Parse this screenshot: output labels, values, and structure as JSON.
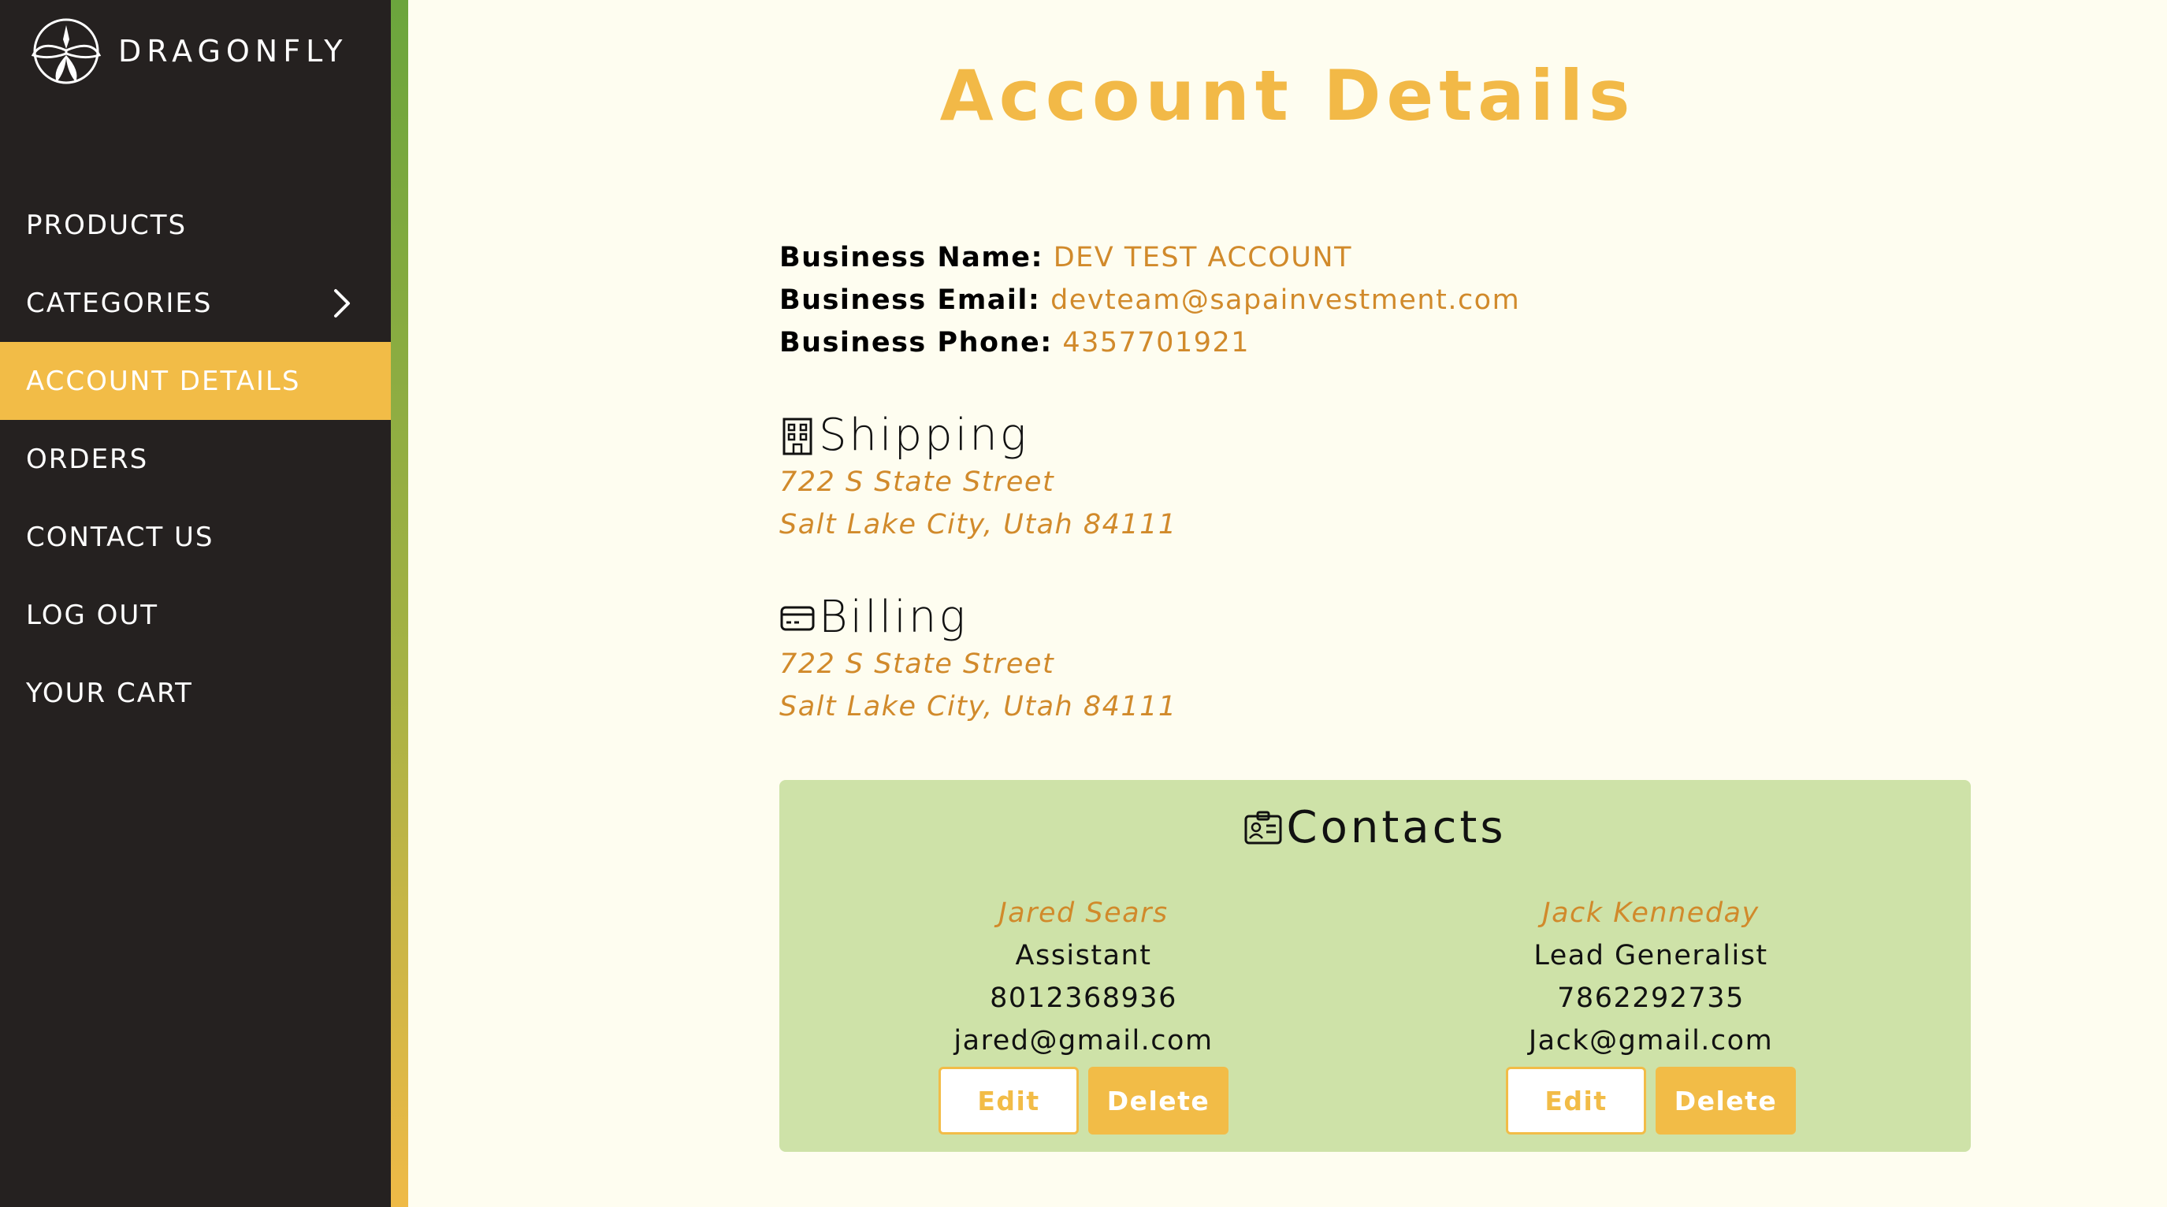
{
  "brand": {
    "name": "DRAGONFLY",
    "icon": "dragonfly-logo-icon"
  },
  "nav": {
    "items": [
      {
        "label": "PRODUCTS"
      },
      {
        "label": "CATEGORIES",
        "icon": "chevron-right-icon"
      },
      {
        "label": "ACCOUNT DETAILS",
        "active": true
      },
      {
        "label": "ORDERS"
      },
      {
        "label": "CONTACT US"
      },
      {
        "label": "LOG OUT"
      },
      {
        "label": "YOUR CART"
      }
    ]
  },
  "page": {
    "title": "Account Details"
  },
  "business": {
    "name_label": "Business Name:",
    "name": "DEV TEST ACCOUNT",
    "email_label": "Business Email:",
    "email": "devteam@sapainvestment.com",
    "phone_label": "Business Phone:",
    "phone": "4357701921"
  },
  "shipping": {
    "heading": "Shipping",
    "icon": "building-icon",
    "line1": "722 S State Street",
    "line2": "Salt Lake City, Utah 84111"
  },
  "billing": {
    "heading": "Billing",
    "icon": "credit-card-icon",
    "line1": "722 S State Street",
    "line2": "Salt Lake City, Utah 84111"
  },
  "contacts": {
    "heading": "Contacts",
    "icon": "id-card-icon",
    "list": [
      {
        "name": "Jared Sears",
        "title": "Assistant",
        "phone": "8012368936",
        "email": "jared@gmail.com",
        "edit_label": "Edit",
        "delete_label": "Delete"
      },
      {
        "name": "Jack Kenneday",
        "title": "Lead Generalist",
        "phone": "7862292735",
        "email": "Jack@gmail.com",
        "edit_label": "Edit",
        "delete_label": "Delete"
      }
    ]
  },
  "colors": {
    "sidebar": "#252120",
    "accent": "#f2bc47",
    "link": "#d18a2b",
    "contacts_bg": "#cee2a8",
    "page_bg": "#fefdf0"
  }
}
